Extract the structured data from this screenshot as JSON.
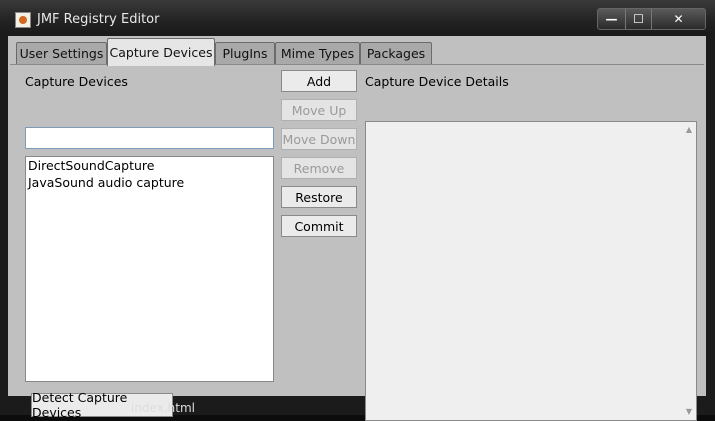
{
  "window": {
    "title": "JMF Registry Editor",
    "controls": {
      "minimize": "—",
      "maximize": "☐",
      "close": "✕"
    }
  },
  "tabs": [
    {
      "label": "User Settings"
    },
    {
      "label": "Capture Devices"
    },
    {
      "label": "PlugIns"
    },
    {
      "label": "Mime Types"
    },
    {
      "label": "Packages"
    }
  ],
  "capture": {
    "list_label": "Capture Devices",
    "input_value": "",
    "devices": [
      "DirectSoundCapture",
      "JavaSound audio capture"
    ],
    "detect_button": "Detect Capture Devices",
    "details_label": "Capture Device  Details"
  },
  "buttons": {
    "add": "Add",
    "move_up": "Move Up",
    "move_down": "Move Down",
    "remove": "Remove",
    "restore": "Restore",
    "commit": "Commit"
  },
  "taskbar": {
    "text": "index.html"
  }
}
